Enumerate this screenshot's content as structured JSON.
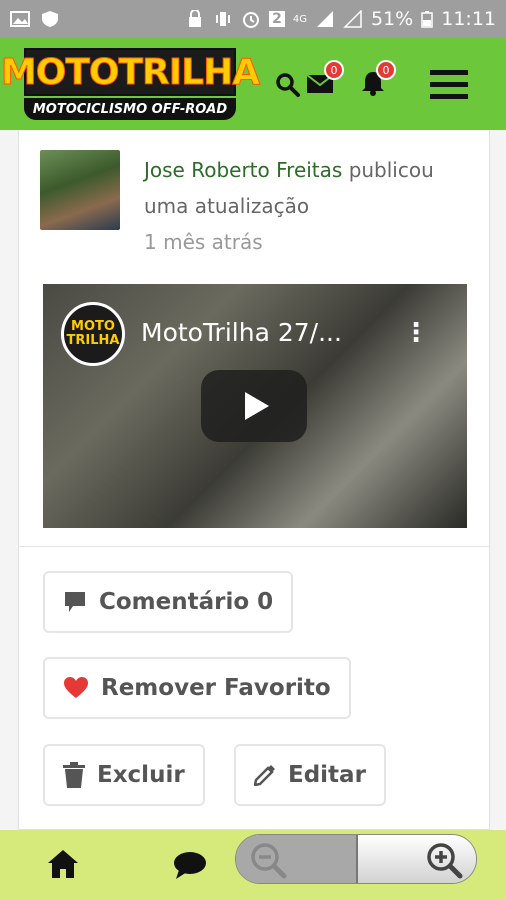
{
  "status_bar": {
    "battery": "51%",
    "time": "11:11",
    "network": "4G",
    "sim": "2"
  },
  "header": {
    "logo_title": "MOTOTRILHA",
    "logo_subtitle": "MOTOCICLISMO OFF-ROAD",
    "messages_count": "0",
    "notifications_count": "0"
  },
  "post": {
    "author": "Jose Roberto Freitas",
    "action": "publicou uma atualização",
    "time_ago": "1 mês atrás",
    "video": {
      "logo_text": "MOTO TRILHA",
      "title": "MotoTrilha 27/..."
    }
  },
  "actions": {
    "comment_label": "Comentário 0",
    "favorite_label": "Remover Favorito",
    "delete_label": "Excluir",
    "edit_label": "Editar"
  },
  "colors": {
    "header_green": "#6cc83a",
    "bottom_bar": "#d6ea7c",
    "author_green": "#2e6b2a",
    "heart_red": "#e53935"
  }
}
